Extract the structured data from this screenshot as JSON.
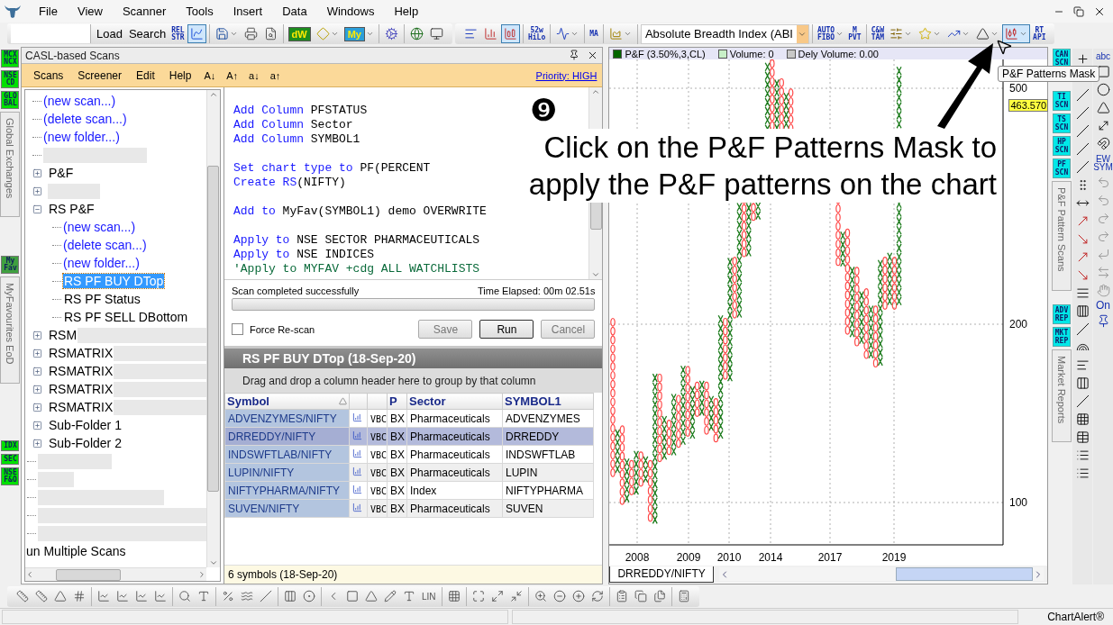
{
  "menu_bar": [
    "File",
    "View",
    "Scanner",
    "Tools",
    "Insert",
    "Data",
    "Windows",
    "Help"
  ],
  "toolbars": [
    {
      "groups": [
        [
          {
            "kind": "text",
            "label": "Load",
            "pressed": false,
            "caret": false
          },
          {
            "kind": "text",
            "label": "Search",
            "pressed": false,
            "caret": false
          },
          {
            "kind": "glyph",
            "label": "REL STR",
            "pressed": false,
            "caret": false
          },
          {
            "kind": "icon",
            "pressed": true,
            "caret": false
          }
        ],
        [
          {
            "kind": "icon",
            "pressed": false,
            "caret": true
          },
          {
            "kind": "icon",
            "pressed": false,
            "caret": false
          },
          {
            "kind": "icon",
            "pressed": false,
            "caret": false
          }
        ],
        [
          {
            "kind": "badge",
            "label": "dW",
            "color": "#1e8c1e",
            "pressed": false,
            "caret": false
          },
          {
            "kind": "icon",
            "pressed": false,
            "caret": true
          },
          {
            "kind": "badge",
            "label": "My",
            "color": "#2b9fd9",
            "pressed": false,
            "caret": true
          }
        ],
        [
          {
            "kind": "icon",
            "pressed": false,
            "caret": false
          }
        ],
        [
          {
            "kind": "icon",
            "pressed": false,
            "caret": false
          },
          {
            "kind": "icon",
            "pressed": false,
            "caret": false
          }
        ]
      ]
    },
    {
      "groups": [
        [
          {
            "kind": "icon",
            "pressed": false,
            "caret": false
          },
          {
            "kind": "icon",
            "pressed": false,
            "caret": false
          },
          {
            "kind": "icon",
            "pressed": true,
            "caret": false
          }
        ],
        [
          {
            "kind": "glyph",
            "label": "52w HiLo",
            "pressed": false,
            "caret": false
          }
        ],
        [
          {
            "kind": "icon",
            "pressed": false,
            "caret": true
          }
        ],
        [
          {
            "kind": "glyph",
            "label": "MA",
            "pressed": false,
            "caret": false
          }
        ],
        [
          {
            "kind": "icon",
            "pressed": false,
            "caret": true
          }
        ],
        [
          {
            "kind": "dropdown",
            "label": "Absolute Breadth Index (ABI",
            "pressed": false,
            "caret": true
          }
        ],
        [
          {
            "kind": "glyph",
            "label": "AUTO FIBO",
            "pressed": false,
            "caret": true
          },
          {
            "kind": "glyph",
            "label": "M PVT",
            "pressed": false,
            "caret": false
          }
        ],
        [
          {
            "kind": "glyph",
            "label": "C&W TAM",
            "pressed": false,
            "caret": false
          },
          {
            "kind": "icon",
            "pressed": false,
            "caret": true
          },
          {
            "kind": "icon",
            "pressed": false,
            "caret": true
          },
          {
            "kind": "icon",
            "pressed": false,
            "caret": true
          },
          {
            "kind": "icon",
            "pressed": false,
            "caret": true
          },
          {
            "kind": "icon",
            "pressed": true,
            "caret": true
          },
          {
            "kind": "glyph",
            "label": "RT API",
            "pressed": false,
            "caret": false
          }
        ]
      ]
    }
  ],
  "left_strip": [
    {
      "kind": "badge",
      "label": "MCX NCX",
      "color": "#00e000"
    },
    {
      "kind": "badge",
      "label": "NSE CD",
      "color": "#00e000"
    },
    {
      "kind": "badge",
      "label": "GLO BAL",
      "color": "#00e000"
    },
    {
      "kind": "vertical",
      "label": "Global Exchanges"
    },
    {
      "kind": "badge",
      "label": "My Fav",
      "color": "#3fa03f"
    },
    {
      "kind": "vertical",
      "label": "MyFavourites EoD"
    },
    {
      "kind": "badge",
      "label": "IDX",
      "color": "#00e000"
    },
    {
      "kind": "badge",
      "label": "SEC",
      "color": "#00e000"
    },
    {
      "kind": "badge",
      "label": "NSE F&O",
      "color": "#00e000"
    }
  ],
  "scan_panel": {
    "title": "CASL-based Scans",
    "menus": [
      "Scans",
      "Screener",
      "Edit",
      "Help"
    ],
    "font_buttons": [
      "A↓",
      "A↑",
      "a↓",
      "a↑"
    ],
    "priority_link": "Priority: HIGH"
  },
  "tree": {
    "items": [
      {
        "kind": "branch",
        "children": [
          {
            "kind": "link",
            "label": "(new scan...)"
          },
          {
            "kind": "link",
            "label": "(delete scan...)"
          },
          {
            "kind": "link",
            "label": "(new folder...)"
          },
          {
            "kind": "masked"
          },
          {
            "kind": "folder",
            "label": "P&F",
            "expanded": false,
            "masked": false
          },
          {
            "kind": "folder",
            "expanded": false,
            "masked": true
          },
          {
            "kind": "folder",
            "label": "RS P&F",
            "expanded": true,
            "masked": false,
            "children": [
              {
                "kind": "link",
                "label": "(new scan...)"
              },
              {
                "kind": "link",
                "label": "(delete scan...)"
              },
              {
                "kind": "link",
                "label": "(new folder...)"
              },
              {
                "kind": "scan",
                "label": "RS PF BUY DTop",
                "selected": true
              },
              {
                "kind": "scan",
                "label": "RS PF Status",
                "selected": false
              },
              {
                "kind": "scan",
                "label": "RS PF SELL DBottom",
                "selected": false
              }
            ]
          },
          {
            "kind": "folder",
            "label": "RSM",
            "expanded": false,
            "masked": true
          },
          {
            "kind": "folder",
            "label": "RSMATRIX",
            "expanded": false,
            "masked": true
          },
          {
            "kind": "folder",
            "label": "RSMATRIX",
            "expanded": false,
            "masked": true
          },
          {
            "kind": "folder",
            "label": "RSMATRIX",
            "expanded": false,
            "masked": true
          },
          {
            "kind": "folder",
            "label": "RSMATRIX",
            "expanded": false,
            "masked": true
          },
          {
            "kind": "folder",
            "label": "Sub-Folder 1",
            "expanded": false,
            "masked": false
          },
          {
            "kind": "folder",
            "label": "Sub-Folder 2",
            "expanded": false,
            "masked": false
          }
        ]
      },
      {
        "kind": "masked"
      },
      {
        "kind": "masked"
      },
      {
        "kind": "masked"
      },
      {
        "kind": "masked"
      },
      {
        "kind": "masked"
      },
      {
        "kind": "scan",
        "label": "un Multiple Scans",
        "selected": false
      }
    ]
  },
  "editor": {
    "lines": [
      {
        "kind": "code",
        "segments": [
          {
            "kind": "keyword",
            "text": "Add Column"
          },
          {
            "kind": "plain",
            "text": " PFSTATUS"
          }
        ]
      },
      {
        "kind": "code",
        "segments": [
          {
            "kind": "keyword",
            "text": "Add Column"
          },
          {
            "kind": "plain",
            "text": " Sector"
          }
        ]
      },
      {
        "kind": "code",
        "segments": [
          {
            "kind": "keyword",
            "text": "Add Column"
          },
          {
            "kind": "plain",
            "text": " SYMBOL1"
          }
        ]
      },
      {
        "kind": "blank"
      },
      {
        "kind": "code",
        "segments": [
          {
            "kind": "keyword",
            "text": "Set chart type to"
          },
          {
            "kind": "plain",
            "text": " PF(PERCENT"
          }
        ]
      },
      {
        "kind": "code",
        "segments": [
          {
            "kind": "keyword",
            "text": "Create RS"
          },
          {
            "kind": "plain",
            "text": "(NIFTY)"
          }
        ]
      },
      {
        "kind": "blank"
      },
      {
        "kind": "code",
        "segments": [
          {
            "kind": "keyword",
            "text": "Add to"
          },
          {
            "kind": "plain",
            "text": " MyFav(SYMBOL1) demo OVERWRITE"
          }
        ]
      },
      {
        "kind": "blank"
      },
      {
        "kind": "code",
        "segments": [
          {
            "kind": "keyword",
            "text": "Apply to"
          },
          {
            "kind": "plain",
            "text": " NSE SECTOR PHARMACEUTICALS"
          }
        ]
      },
      {
        "kind": "code",
        "segments": [
          {
            "kind": "keyword",
            "text": "Apply to"
          },
          {
            "kind": "plain",
            "text": " NSE INDICES"
          }
        ]
      },
      {
        "kind": "code",
        "segments": [
          {
            "kind": "comment",
            "text": "'Apply to MYFAV +cdg ALL WATCHLISTS"
          }
        ]
      }
    ]
  },
  "scan_status": {
    "message": "Scan completed successfully",
    "elapsed": "Time Elapsed: 00m 02.51s",
    "level": 0
  },
  "force_rescan": {
    "label": "Force Re-scan",
    "checked": false
  },
  "buttons": [
    {
      "label": "Save",
      "disabled": true
    },
    {
      "label": "Run",
      "disabled": false
    },
    {
      "label": "Cancel",
      "disabled": true
    }
  ],
  "results": {
    "title": "RS PF BUY DTop (18-Sep-20)",
    "group_hint": "Drag and drop a column header here to group by that column",
    "columns": [
      {
        "label": "Symbol",
        "sorted": true
      },
      {
        "label": "P",
        "sorted": false
      },
      {
        "label": "Sector",
        "sorted": false
      },
      {
        "label": "SYMBOL1",
        "sorted": false
      }
    ],
    "rows": [
      {
        "symbol": "ADVENZYMES/NIFTY",
        "column_3": "VBC",
        "p": "BX",
        "sector": "Pharmaceuticals",
        "symbol1": "ADVENZYMES",
        "selected": false
      },
      {
        "symbol": "DRREDDY/NIFTY",
        "column_3": "VBC",
        "p": "BX",
        "sector": "Pharmaceuticals",
        "symbol1": "DRREDDY",
        "selected": true
      },
      {
        "symbol": "INDSWFTLAB/NIFTY",
        "column_3": "VBC",
        "p": "BX",
        "sector": "Pharmaceuticals",
        "symbol1": "INDSWFTLAB",
        "selected": false
      },
      {
        "symbol": "LUPIN/NIFTY",
        "column_3": "VBC",
        "p": "BX",
        "sector": "Pharmaceuticals",
        "symbol1": "LUPIN",
        "selected": false
      },
      {
        "symbol": "NIFTYPHARMA/NIFTY",
        "column_3": "VBC",
        "p": "BX",
        "sector": "Index",
        "symbol1": "NIFTYPHARMA",
        "selected": false
      },
      {
        "symbol": "SUVEN/NIFTY",
        "column_3": "VBC",
        "p": "BX",
        "sector": "Pharmaceuticals",
        "symbol1": "SUVEN",
        "selected": false
      }
    ],
    "footer": "6 symbols (18-Sep-20)"
  },
  "chart": {
    "legend": [
      {
        "label": "P&F (3.50%,3,CL)",
        "color": "#006400"
      },
      {
        "label": "Volume: 0",
        "color": "#c8f0c8"
      },
      {
        "label": "Dely Volume: 0.00",
        "color": "#c8c8c8"
      }
    ],
    "y_axis_labels": [
      "500",
      "200",
      "100"
    ],
    "x_axis_labels": [
      "2008",
      "2009",
      "2010",
      "2014",
      "2017",
      "2019"
    ],
    "price_label": "463.570",
    "tab": "DRREDDY/NIFTY"
  },
  "right_strip": [
    {
      "kind": "badge",
      "label": "CAN SCN"
    },
    {
      "kind": "badge",
      "label": "TI SCN"
    },
    {
      "kind": "badge",
      "label": "TS SCN"
    },
    {
      "kind": "badge",
      "label": "HP SCN"
    },
    {
      "kind": "badge",
      "label": "PF SCN"
    },
    {
      "kind": "vertical",
      "label": "P&F Pattern Scans"
    },
    {
      "kind": "badge",
      "label": "ADV REP"
    },
    {
      "kind": "badge",
      "label": "MKT REP"
    },
    {
      "kind": "vertical",
      "label": "Market Reports"
    }
  ],
  "right_tools": {
    "labels": [
      "abc",
      "EW SYM",
      "On"
    ]
  },
  "bottom_toolbar": {
    "text_button": "LIN"
  },
  "annotation": {
    "step": "❾",
    "lines": [
      "Click on the P&F Patterns Mask to",
      "apply the P&F patterns on the chart"
    ],
    "tooltip": "P&F Patterns Mask"
  },
  "status_bar": {
    "app_name": "ChartAlert®"
  }
}
